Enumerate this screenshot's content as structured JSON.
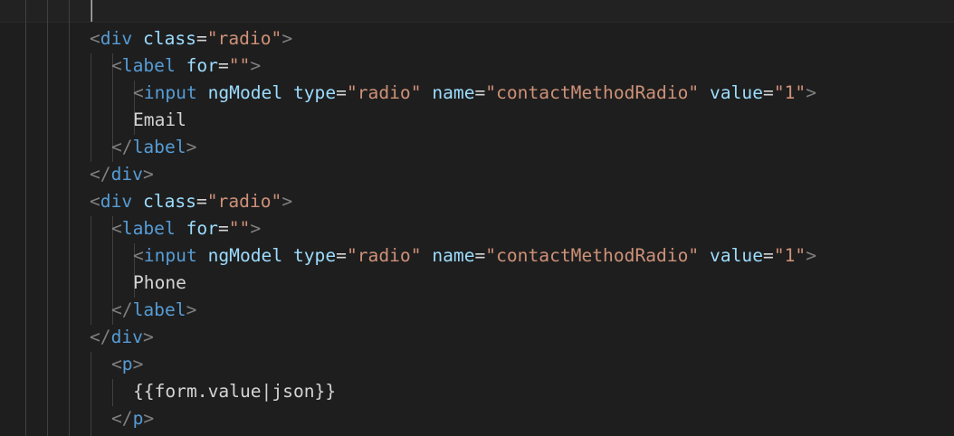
{
  "editor": {
    "lines": [
      {
        "id": "l1",
        "tokens": [
          {
            "t": "<",
            "c": "t-br"
          },
          {
            "t": "div",
            "c": "t-tag"
          },
          {
            "t": " "
          },
          {
            "t": "class",
            "c": "t-attr"
          },
          {
            "t": "=",
            "c": "t-eq"
          },
          {
            "t": "\"radio\"",
            "c": "t-str"
          },
          {
            "t": ">",
            "c": "t-br"
          }
        ]
      },
      {
        "id": "l2",
        "tokens": [
          {
            "t": "<",
            "c": "t-br"
          },
          {
            "t": "label",
            "c": "t-tag"
          },
          {
            "t": " "
          },
          {
            "t": "for",
            "c": "t-attr"
          },
          {
            "t": "=",
            "c": "t-eq"
          },
          {
            "t": "\"\"",
            "c": "t-str"
          },
          {
            "t": ">",
            "c": "t-br"
          }
        ]
      },
      {
        "id": "l3",
        "tokens": [
          {
            "t": "<",
            "c": "t-br"
          },
          {
            "t": "input",
            "c": "t-tag"
          },
          {
            "t": " "
          },
          {
            "t": "ngModel",
            "c": "t-attr"
          },
          {
            "t": " "
          },
          {
            "t": "type",
            "c": "t-attr"
          },
          {
            "t": "=",
            "c": "t-eq"
          },
          {
            "t": "\"radio\"",
            "c": "t-str"
          },
          {
            "t": " "
          },
          {
            "t": "name",
            "c": "t-attr"
          },
          {
            "t": "=",
            "c": "t-eq"
          },
          {
            "t": "\"contactMethodRadio\"",
            "c": "t-str"
          },
          {
            "t": " "
          },
          {
            "t": "value",
            "c": "t-attr"
          },
          {
            "t": "=",
            "c": "t-eq"
          },
          {
            "t": "\"1\"",
            "c": "t-str"
          },
          {
            "t": ">",
            "c": "t-br"
          }
        ]
      },
      {
        "id": "l4",
        "tokens": [
          {
            "t": "Email",
            "c": "t-text"
          }
        ]
      },
      {
        "id": "l5",
        "tokens": [
          {
            "t": "</",
            "c": "t-br"
          },
          {
            "t": "label",
            "c": "t-tag"
          },
          {
            "t": ">",
            "c": "t-br"
          }
        ]
      },
      {
        "id": "l6",
        "tokens": [
          {
            "t": "</",
            "c": "t-br"
          },
          {
            "t": "div",
            "c": "t-tag"
          },
          {
            "t": ">",
            "c": "t-br"
          }
        ]
      },
      {
        "id": "l7",
        "tokens": [
          {
            "t": "<",
            "c": "t-br"
          },
          {
            "t": "div",
            "c": "t-tag"
          },
          {
            "t": " "
          },
          {
            "t": "class",
            "c": "t-attr"
          },
          {
            "t": "=",
            "c": "t-eq"
          },
          {
            "t": "\"radio\"",
            "c": "t-str"
          },
          {
            "t": ">",
            "c": "t-br"
          }
        ]
      },
      {
        "id": "l8",
        "tokens": [
          {
            "t": "<",
            "c": "t-br"
          },
          {
            "t": "label",
            "c": "t-tag"
          },
          {
            "t": " "
          },
          {
            "t": "for",
            "c": "t-attr"
          },
          {
            "t": "=",
            "c": "t-eq"
          },
          {
            "t": "\"\"",
            "c": "t-str"
          },
          {
            "t": ">",
            "c": "t-br"
          }
        ]
      },
      {
        "id": "l9",
        "tokens": [
          {
            "t": "<",
            "c": "t-br"
          },
          {
            "t": "input",
            "c": "t-tag"
          },
          {
            "t": " "
          },
          {
            "t": "ngModel",
            "c": "t-attr"
          },
          {
            "t": " "
          },
          {
            "t": "type",
            "c": "t-attr"
          },
          {
            "t": "=",
            "c": "t-eq"
          },
          {
            "t": "\"radio\"",
            "c": "t-str"
          },
          {
            "t": " "
          },
          {
            "t": "name",
            "c": "t-attr"
          },
          {
            "t": "=",
            "c": "t-eq"
          },
          {
            "t": "\"contactMethodRadio\"",
            "c": "t-str"
          },
          {
            "t": " "
          },
          {
            "t": "value",
            "c": "t-attr"
          },
          {
            "t": "=",
            "c": "t-eq"
          },
          {
            "t": "\"1\"",
            "c": "t-str"
          },
          {
            "t": ">",
            "c": "t-br"
          }
        ]
      },
      {
        "id": "l10",
        "tokens": [
          {
            "t": "Phone",
            "c": "t-text"
          }
        ]
      },
      {
        "id": "l11",
        "tokens": [
          {
            "t": "</",
            "c": "t-br"
          },
          {
            "t": "label",
            "c": "t-tag"
          },
          {
            "t": ">",
            "c": "t-br"
          }
        ]
      },
      {
        "id": "l12",
        "tokens": [
          {
            "t": "</",
            "c": "t-br"
          },
          {
            "t": "div",
            "c": "t-tag"
          },
          {
            "t": ">",
            "c": "t-br"
          }
        ]
      },
      {
        "id": "l13",
        "tokens": [
          {
            "t": "<",
            "c": "t-br"
          },
          {
            "t": "p",
            "c": "t-tag"
          },
          {
            "t": ">",
            "c": "t-br"
          }
        ]
      },
      {
        "id": "l14",
        "tokens": [
          {
            "t": "{{form.value|json}}",
            "c": "t-text"
          }
        ]
      },
      {
        "id": "l15",
        "tokens": [
          {
            "t": "</",
            "c": "t-br"
          },
          {
            "t": "p",
            "c": "t-tag"
          },
          {
            "t": ">",
            "c": "t-br"
          }
        ]
      }
    ]
  },
  "colors": {
    "background": "#1e1e1e",
    "tag": "#569cd6",
    "bracket": "#808080",
    "attribute": "#9cdcfe",
    "string": "#ce9178",
    "text": "#d4d4d4"
  }
}
